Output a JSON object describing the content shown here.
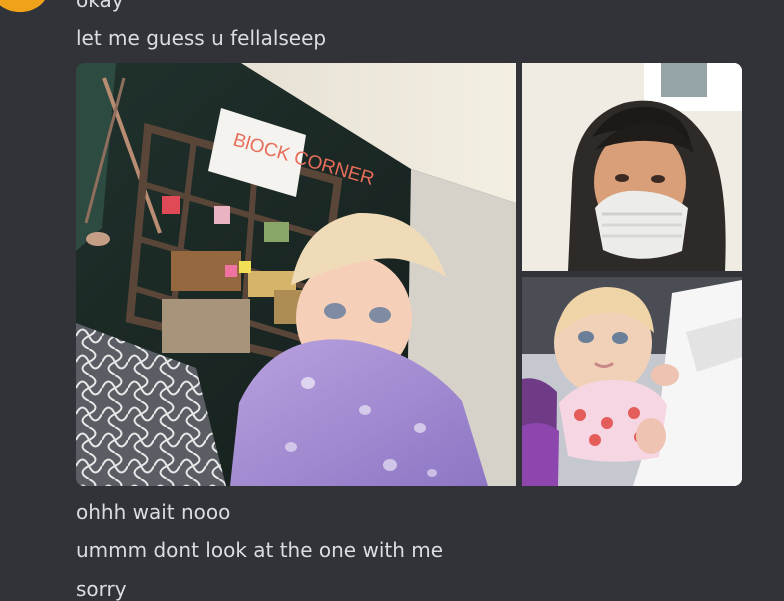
{
  "messages": [
    {
      "text": "okay"
    },
    {
      "text": "let me guess u fellalseep"
    },
    {
      "text": "ohhh wait nooo"
    },
    {
      "text": "ummm dont look at the one with me"
    },
    {
      "text": "sorry"
    }
  ],
  "attachments": {
    "image_count": 3,
    "images": [
      {
        "kind": "photo",
        "sign_text": "BlOCK CORNER"
      },
      {
        "kind": "photo"
      },
      {
        "kind": "photo"
      }
    ]
  }
}
